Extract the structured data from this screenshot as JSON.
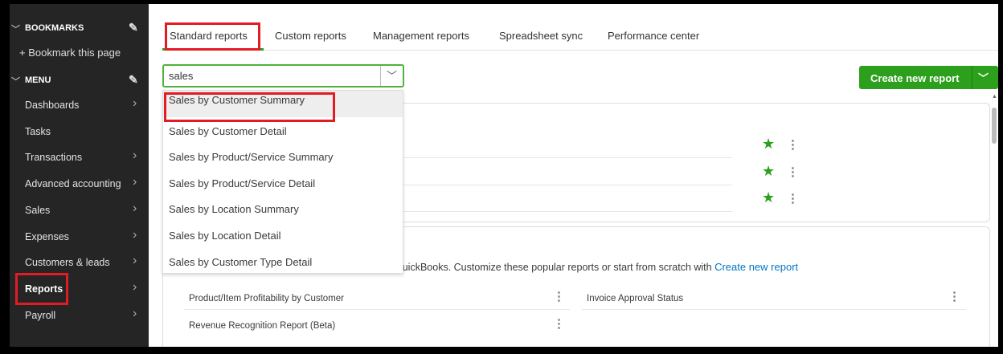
{
  "sidebar": {
    "bookmarks_label": "BOOKMARKS",
    "bookmark_this_page": "Bookmark this page",
    "menu_label": "MENU",
    "items": [
      {
        "label": "Dashboards",
        "arrow": true
      },
      {
        "label": "Tasks",
        "arrow": false
      },
      {
        "label": "Transactions",
        "arrow": true
      },
      {
        "label": "Advanced accounting",
        "arrow": true
      },
      {
        "label": "Sales",
        "arrow": true
      },
      {
        "label": "Expenses",
        "arrow": true
      },
      {
        "label": "Customers & leads",
        "arrow": true
      },
      {
        "label": "Reports",
        "arrow": true
      },
      {
        "label": "Payroll",
        "arrow": true
      }
    ]
  },
  "tabs": [
    "Standard reports",
    "Custom reports",
    "Management reports",
    "Spreadsheet sync",
    "Performance center"
  ],
  "search": {
    "value": "sales"
  },
  "dropdown": [
    "Sales by Customer Summary",
    "Sales by Customer Detail",
    "Sales by Product/Service Summary",
    "Sales by Product/Service Detail",
    "Sales by Location Summary",
    "Sales by Location Detail",
    "Sales by Customer Type Detail"
  ],
  "create_button": "Create new report",
  "popular": {
    "description": "QuickBooks. Customize these popular reports or start from scratch with",
    "link": "Create new report",
    "reports": [
      "Product/Item Profitability by Customer",
      "Invoice Approval Status",
      "Revenue Recognition Report (Beta)"
    ]
  },
  "colors": {
    "accent": "#2ca01c",
    "highlight": "#e21b25",
    "link": "#0077c5",
    "sidebar": "#252525"
  }
}
